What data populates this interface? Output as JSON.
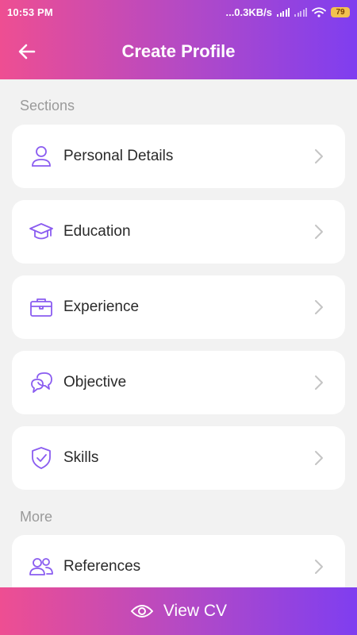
{
  "status_bar": {
    "time": "10:53 PM",
    "network_speed": "...0.3KB/s",
    "battery": "79"
  },
  "app_bar": {
    "title": "Create Profile",
    "back_icon": "arrow-left-icon"
  },
  "sections_label": "Sections",
  "sections": [
    {
      "label": "Personal Details",
      "icon": "person-icon"
    },
    {
      "label": "Education",
      "icon": "graduation-cap-icon"
    },
    {
      "label": "Experience",
      "icon": "briefcase-icon"
    },
    {
      "label": "Objective",
      "icon": "chat-bubbles-icon"
    },
    {
      "label": "Skills",
      "icon": "shield-check-icon"
    }
  ],
  "more_label": "More",
  "more": [
    {
      "label": "References",
      "icon": "people-icon"
    }
  ],
  "bottom_bar": {
    "label": "View CV",
    "icon": "eye-icon"
  },
  "colors": {
    "gradient_start": "#ee4e92",
    "gradient_end": "#7f3ef0",
    "icon_purple": "#8a5cf0",
    "chevron": "#c4c4c4"
  }
}
